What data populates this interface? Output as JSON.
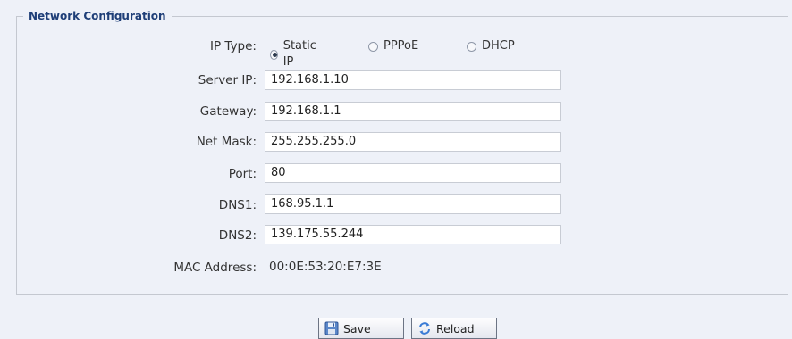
{
  "section": {
    "title": "Network Configuration"
  },
  "ip_type": {
    "label": "IP Type:",
    "options": [
      {
        "label": "Static IP",
        "checked": true
      },
      {
        "label": "PPPoE",
        "checked": false
      },
      {
        "label": "DHCP",
        "checked": false
      }
    ]
  },
  "fields": {
    "server_ip": {
      "label": "Server IP:",
      "value": "192.168.1.10"
    },
    "gateway": {
      "label": "Gateway:",
      "value": "192.168.1.1"
    },
    "net_mask": {
      "label": "Net Mask:",
      "value": "255.255.255.0"
    },
    "port": {
      "label": "Port:",
      "value": "80"
    },
    "dns1": {
      "label": "DNS1:",
      "value": "168.95.1.1"
    },
    "dns2": {
      "label": "DNS2:",
      "value": "139.175.55.244"
    }
  },
  "mac": {
    "label": "MAC Address:",
    "value": "00:0E:53:20:E7:3E"
  },
  "buttons": {
    "save": {
      "label": "Save",
      "icon": "save-icon"
    },
    "reload": {
      "label": "Reload",
      "icon": "reload-icon"
    }
  }
}
